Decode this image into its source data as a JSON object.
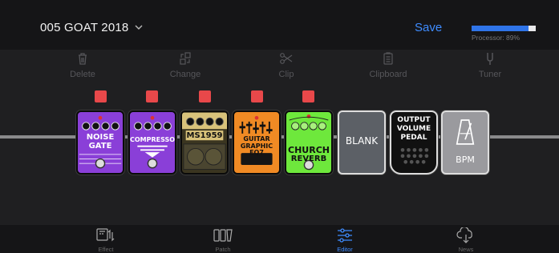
{
  "header": {
    "patch_name": "005 GOAT 2018",
    "save_label": "Save",
    "processor_label": "Processor: 89%",
    "processor_percent": 89
  },
  "toolbar": [
    {
      "label": "Delete",
      "icon": "trash-icon"
    },
    {
      "label": "Change",
      "icon": "swap-icon"
    },
    {
      "label": "Clip",
      "icon": "scissors-icon"
    },
    {
      "label": "Clipboard",
      "icon": "clipboard-icon"
    },
    {
      "label": "Tuner",
      "icon": "tuning-fork-icon"
    }
  ],
  "pedals": [
    {
      "name": "NOISE GATE",
      "line1": "NOISE",
      "line2": "GATE",
      "color": "#8a3fd8",
      "selected_indicator": true
    },
    {
      "name": "COMPRESSOR",
      "line1": "COMPRESSOR",
      "color": "#8a3fd8",
      "selected_indicator": true
    },
    {
      "name": "MS1959",
      "line1": "MS1959",
      "color": "#d8c27a",
      "selected_indicator": true
    },
    {
      "name": "GUITAR GRAPHIC EQ7",
      "line1": "GUITAR",
      "line2": "GRAPHIC EQ7",
      "color": "#f08a24",
      "selected_indicator": true
    },
    {
      "name": "CHURCH REVERB",
      "line1": "CHURCH",
      "line2": "REVERB",
      "color": "#6ee83c",
      "selected_indicator": true
    },
    {
      "name": "BLANK",
      "line1": "BLANK",
      "color": "#5c6066",
      "selected_indicator": false
    },
    {
      "name": "OUTPUT VOLUME PEDAL",
      "line1": "OUTPUT",
      "line2": "VOLUME",
      "line3": "PEDAL",
      "color": "#111111",
      "selected_indicator": false
    },
    {
      "name": "BPM",
      "line1": "BPM",
      "color": "#9a9a9e",
      "selected_indicator": false
    }
  ],
  "tabs": [
    {
      "label": "Effect",
      "icon": "effect-icon",
      "active": false
    },
    {
      "label": "Patch",
      "icon": "patch-icon",
      "active": false
    },
    {
      "label": "Editor",
      "icon": "sliders-icon",
      "active": true
    },
    {
      "label": "News",
      "icon": "cloud-download-icon",
      "active": false
    }
  ],
  "colors": {
    "accent": "#3f8cff",
    "selection_red": "#e8484a"
  }
}
